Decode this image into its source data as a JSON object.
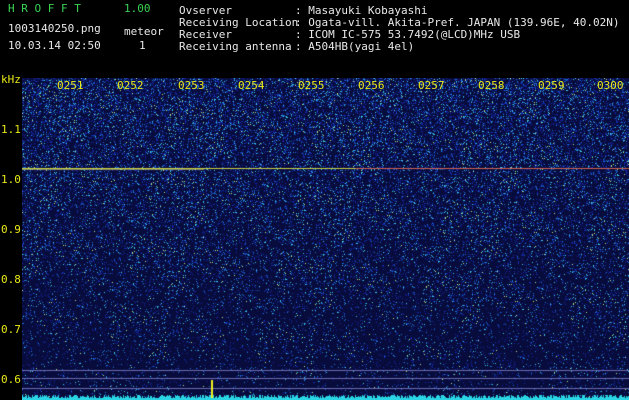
{
  "app": {
    "title": "H R O F F T",
    "version": "1.00",
    "filename": "1003140250.png",
    "datetime": "10.03.14 02:50",
    "meteor_label": "meteor",
    "meteor_count": "1"
  },
  "station": {
    "observer_label": "Ovserver",
    "observer_value": ": Masayuki Kobayashi",
    "location_label": "Receiving Location",
    "location_value": ": Ogata-vill. Akita-Pref. JAPAN (139.96E, 40.02N)",
    "receiver_label": "Receiver",
    "receiver_value": ": ICOM IC-575 53.7492(@LCD)MHz USB",
    "antenna_label": "Receiving antenna",
    "antenna_value": ": A504HB(yagi 4el)"
  },
  "axis": {
    "unit": "kHz",
    "y_ticks": [
      "1.1",
      "1.0",
      "0.9",
      "0.8",
      "0.7",
      "0.6"
    ],
    "time_ticks": [
      "0251",
      "0252",
      "0253",
      "0254",
      "0255",
      "0256",
      "0257",
      "0258",
      "0259",
      "0300"
    ]
  },
  "colors": {
    "background": "#000000",
    "header_green": "#39d353",
    "label_yellow": "#e8e817",
    "spectrum_blue": "#1a2a9a",
    "noise_cyan": "#2ad6e6",
    "carrier": "#c8d040"
  }
}
